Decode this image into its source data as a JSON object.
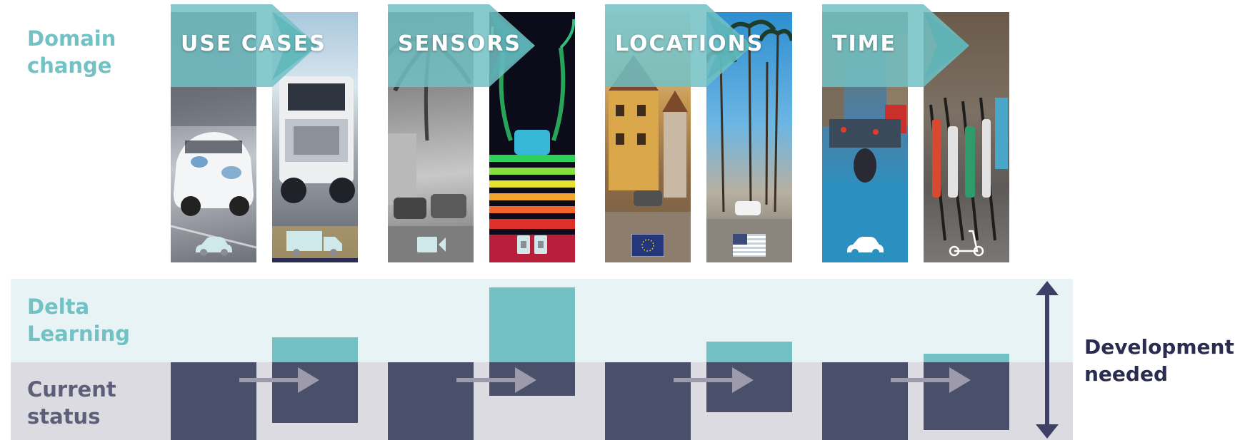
{
  "labels": {
    "domain_change": "Domain\nchange",
    "delta_learning": "Delta\nLearning",
    "current_status": "Current\nstatus",
    "development_needed": "Development\nneeded"
  },
  "domains": [
    {
      "title": "USE CASES",
      "before_icon": "car-icon",
      "after_icon": "truck-icon",
      "current_status_level": 1.0,
      "after_current_level": 0.78,
      "delta_level": 0.3
    },
    {
      "title": "SENSORS",
      "before_icon": "camera-icon",
      "after_icon": "lidar-sensor-icon",
      "current_status_level": 1.0,
      "after_current_level": 0.43,
      "delta_level": 0.9
    },
    {
      "title": "LOCATIONS",
      "before_icon": "eu-flag-icon",
      "after_icon": "us-flag-icon",
      "current_status_level": 1.0,
      "after_current_level": 0.64,
      "delta_level": 0.25
    },
    {
      "title": "TIME",
      "before_icon": "car-icon",
      "after_icon": "e-scooter-icon",
      "current_status_level": 1.0,
      "after_current_level": 0.87,
      "delta_level": 0.1
    }
  ],
  "colors": {
    "teal": "#72c1c4",
    "navy_bar": "#4a506a",
    "navy_text": "#2b2c52",
    "delta_band": "#e7f3f4",
    "current_band": "#dcdbe2",
    "arrow_gray": "#9c9aab"
  }
}
